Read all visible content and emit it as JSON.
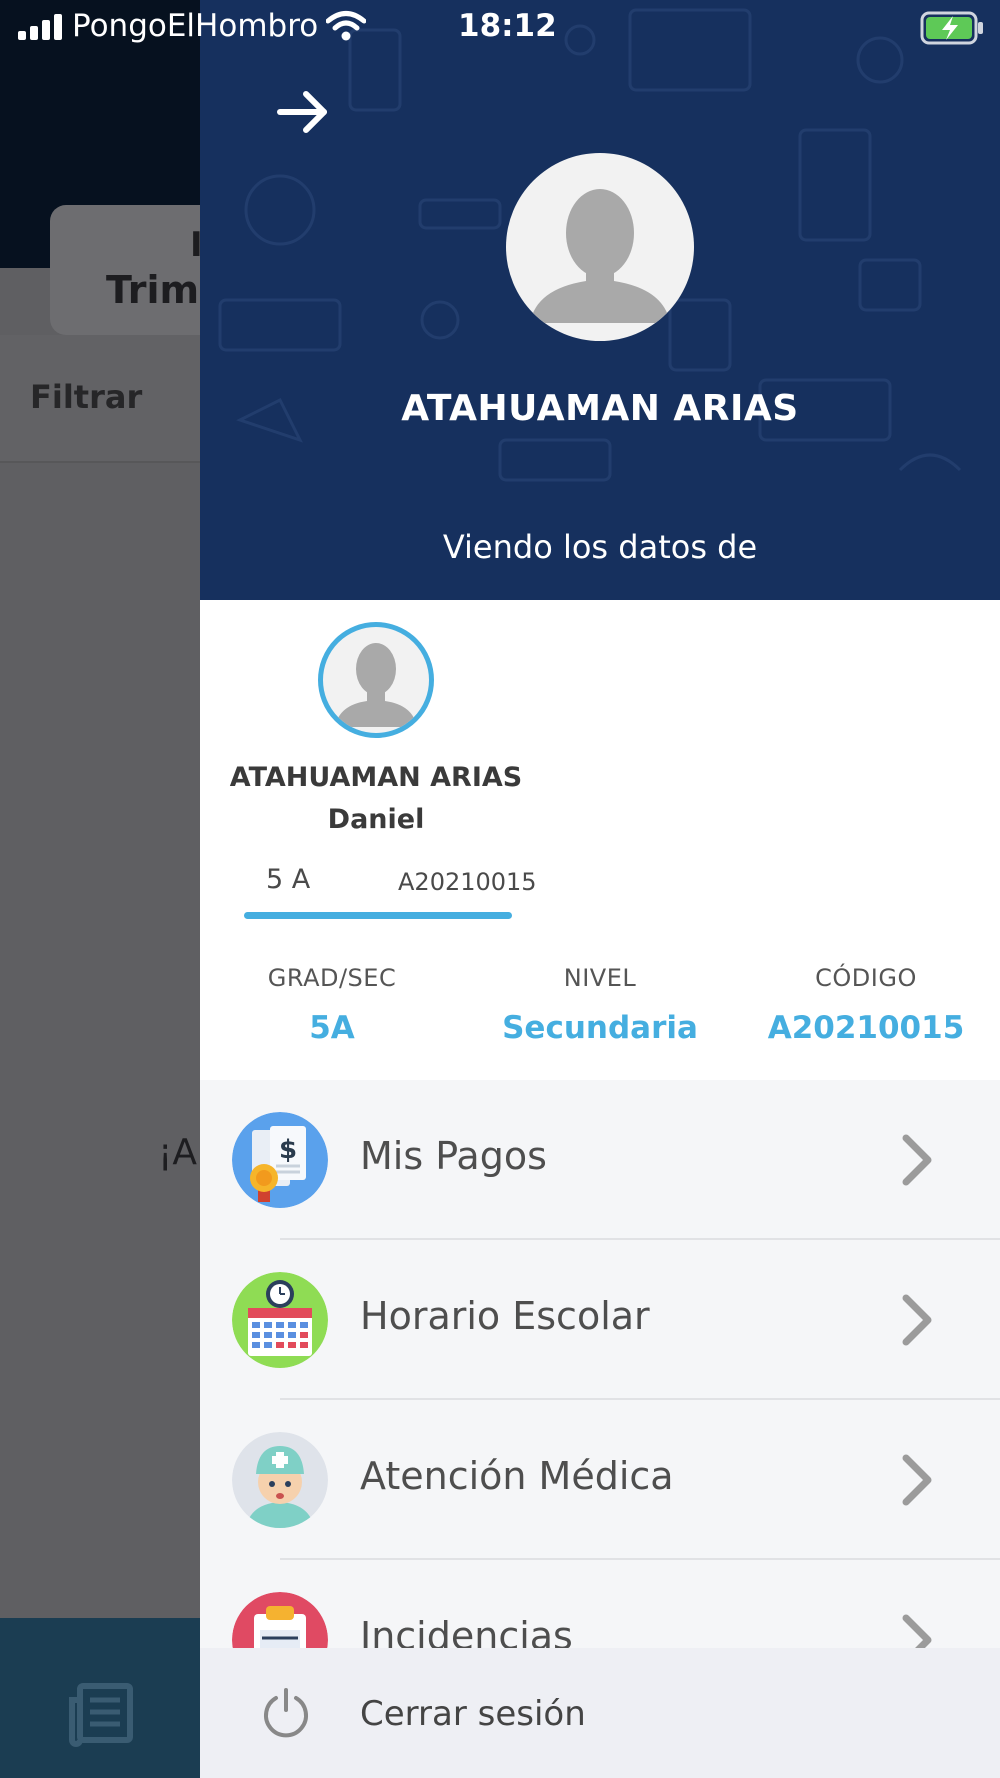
{
  "status_bar": {
    "carrier": "PongoElHombro",
    "time": "18:12"
  },
  "background_app": {
    "card_title_partial": "I",
    "card_subtitle_partial": "Trime",
    "filter_label": "Filtrar",
    "message_partial": "¡A"
  },
  "drawer": {
    "header_name": "ATAHUAMAN ARIAS",
    "viewing_label": "Viendo los datos de",
    "student": {
      "last_name": "ATAHUAMAN ARIAS",
      "first_name": "Daniel",
      "chip_section": "5 A",
      "chip_code": "A20210015"
    },
    "info": [
      {
        "label": "GRAD/SEC",
        "value": "5A"
      },
      {
        "label": "NIVEL",
        "value": "Secundaria"
      },
      {
        "label": "CÓDIGO",
        "value": "A20210015"
      }
    ],
    "menu": [
      {
        "label": "Mis Pagos",
        "icon": "payments-icon"
      },
      {
        "label": "Horario Escolar",
        "icon": "calendar-icon"
      },
      {
        "label": "Atención Médica",
        "icon": "doctor-icon"
      },
      {
        "label": "Incidencias",
        "icon": "clipboard-icon"
      }
    ],
    "logout_label": "Cerrar sesión"
  },
  "colors": {
    "header_bg": "#16305e",
    "accent": "#45aee0",
    "overlay": "#5f5f62"
  }
}
